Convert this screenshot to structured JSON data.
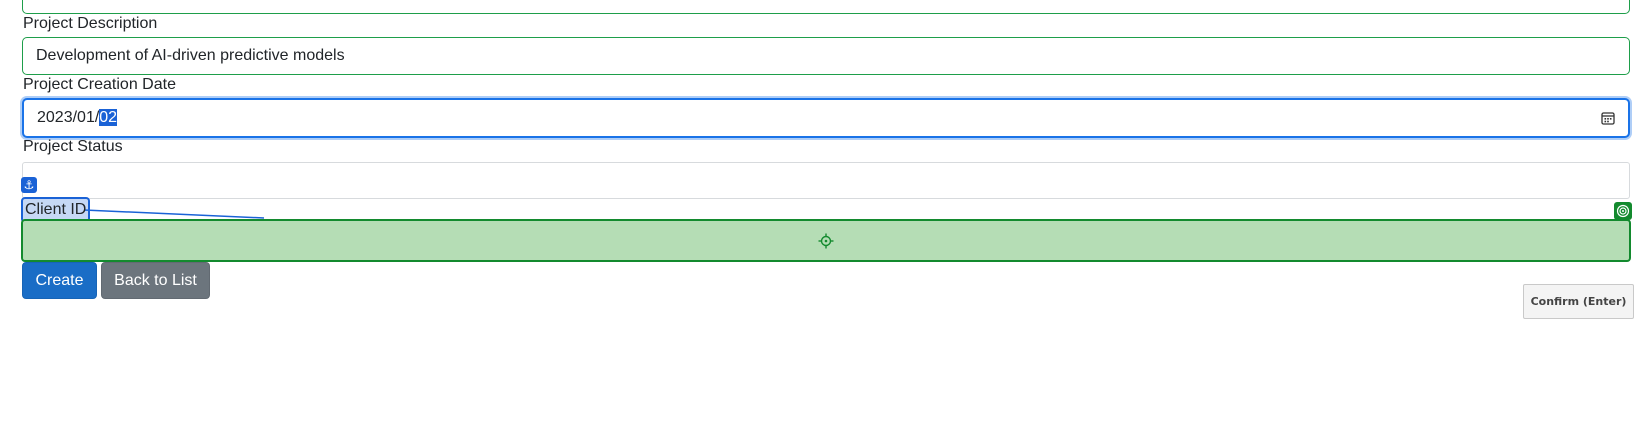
{
  "form": {
    "top_field_value": "",
    "description": {
      "label": "Project Description",
      "value": "Development of AI-driven predictive models"
    },
    "creation_date": {
      "label": "Project Creation Date",
      "value_prefix": "2023/01/",
      "value_selected": "02"
    },
    "status": {
      "label": "Project Status",
      "value": ""
    },
    "client_id": {
      "label": "Client ID",
      "value": ""
    }
  },
  "buttons": {
    "create_label": "Create",
    "back_label": "Back to List"
  },
  "overlay": {
    "confirm_label": "Confirm (Enter)",
    "anchor_symbol": "⚓",
    "colors": {
      "source": "#1a62d6",
      "target": "#138a2e",
      "target_fill": "#b5ddb5"
    }
  }
}
